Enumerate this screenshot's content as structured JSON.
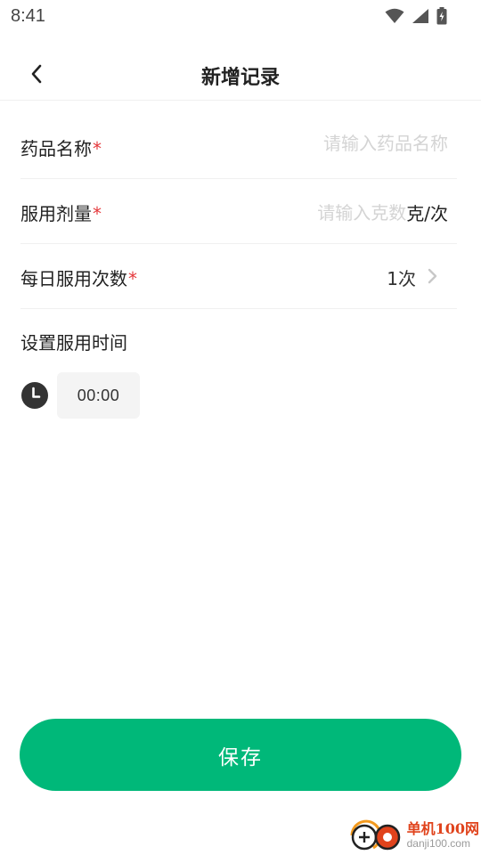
{
  "status_bar": {
    "time": "8:41"
  },
  "nav": {
    "title": "新增记录"
  },
  "form": {
    "medicine_name": {
      "label": "药品名称",
      "required_mark": "*",
      "placeholder": "请输入药品名称",
      "value": ""
    },
    "dosage": {
      "label": "服用剂量",
      "required_mark": "*",
      "placeholder": "请输入克数",
      "value": "",
      "unit": "克/次"
    },
    "daily_times": {
      "label": "每日服用次数",
      "required_mark": "*",
      "value": "1次"
    }
  },
  "schedule": {
    "title": "设置服用时间",
    "times": [
      "00:00"
    ]
  },
  "actions": {
    "save_label": "保存"
  },
  "watermark": {
    "title": "单机100网",
    "domain": "danji100.com"
  },
  "colors": {
    "accent": "#00b879",
    "required": "#e5383b",
    "placeholder": "#d4d4d4"
  }
}
